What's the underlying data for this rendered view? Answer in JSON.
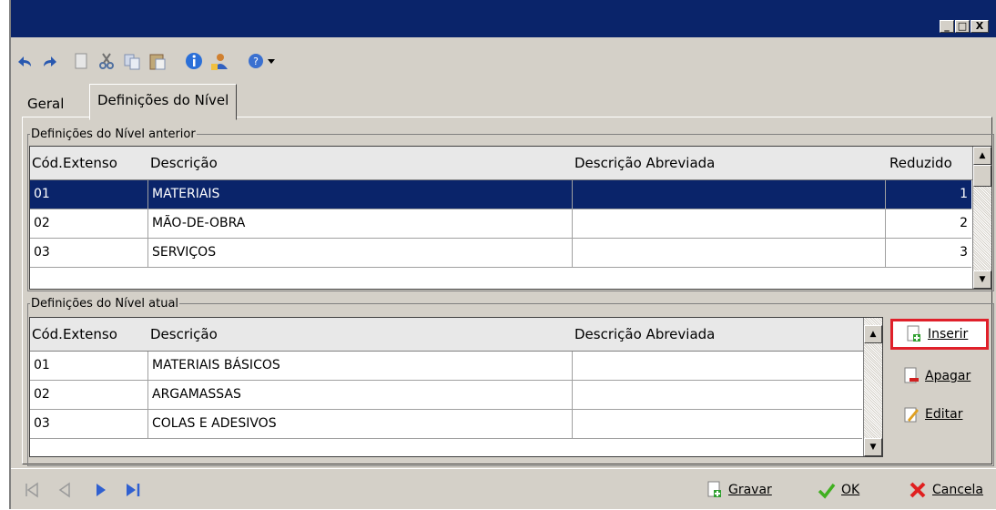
{
  "window": {
    "title": "",
    "controls": [
      "_",
      "□",
      "X"
    ]
  },
  "toolbar": {
    "icons": [
      "undo-icon",
      "redo-icon",
      "new-doc-icon",
      "cut-icon",
      "copy-icon",
      "paste-icon",
      "info-icon",
      "user-icon",
      "help-icon",
      "dropdown-arrow-icon"
    ]
  },
  "tabs": [
    {
      "label": "Geral"
    },
    {
      "label": "Definições do Nível"
    }
  ],
  "prev_level": {
    "legend": "Definições do Nível anterior",
    "columns": [
      "Cód.Extenso",
      "Descrição",
      "Descrição Abreviada",
      "Reduzido"
    ],
    "rows": [
      {
        "code": "01",
        "desc": "MATERIAIS",
        "abbr": "",
        "reduced": "1"
      },
      {
        "code": "02",
        "desc": "MÃO-DE-OBRA",
        "abbr": "",
        "reduced": "2"
      },
      {
        "code": "03",
        "desc": "SERVIÇOS",
        "abbr": "",
        "reduced": "3"
      }
    ]
  },
  "curr_level": {
    "legend": "Definições do Nível atual",
    "columns": [
      "Cód.Extenso",
      "Descrição",
      "Descrição Abreviada"
    ],
    "rows": [
      {
        "code": "01",
        "desc": "MATERIAIS BÁSICOS",
        "abbr": ""
      },
      {
        "code": "02",
        "desc": "ARGAMASSAS",
        "abbr": ""
      },
      {
        "code": "03",
        "desc": "COLAS E ADESIVOS",
        "abbr": ""
      }
    ]
  },
  "side_buttons": {
    "insert": "Inserir",
    "delete": "Apagar",
    "edit": "Editar"
  },
  "footer": {
    "save": "Gravar",
    "ok": "OK",
    "cancel": "Cancela"
  },
  "colors": {
    "selection": "#0a246a",
    "highlight_border": "#e0202a",
    "titlebar": "#0a246a"
  }
}
